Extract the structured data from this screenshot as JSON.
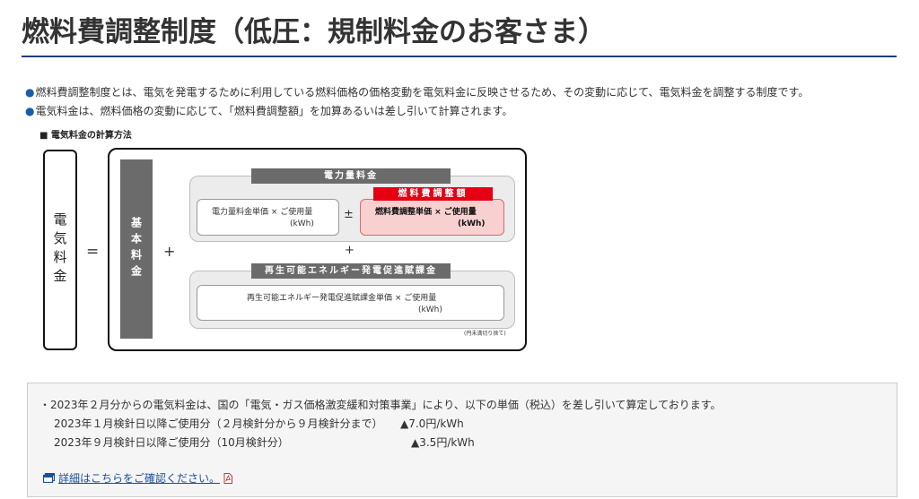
{
  "page": {
    "title": "燃料費調整制度（低圧：規制料金のお客さま）"
  },
  "bullets": [
    "燃料費調整制度とは、電気を発電するために利用している燃料価格の価格変動を電気料金に反映させるため、その変動に応じて、電気料金を調整する制度です。",
    "電気料金は、燃料価格の変動に応じて、「燃料費調整額」を加算あるいは差し引いて計算されます。"
  ],
  "bullet_marker": "●",
  "figure": {
    "caption": "■ 電気料金の計算方法",
    "denki_ryokin": "電気料金",
    "equals": "=",
    "kihon_ryokin": "基本料金",
    "plus": "+",
    "plus_minus": "±",
    "denryoku_panel": {
      "header": "電力量料金",
      "left_line1": "電力量料金単価 × ご使用量",
      "left_line2": "(kWh)",
      "fuel_label": "燃料費調整額",
      "fuel_line1": "燃料費調整単価 × ご使用量",
      "fuel_line2": "(kWh)"
    },
    "saiene_panel": {
      "header": "再生可能エネルギー発電促進賦課金",
      "line1": "再生可能エネルギー発電促進賦課金単価 × ご使用量",
      "line2": "(kWh)"
    },
    "note": "(円未満切り捨て)"
  },
  "info": {
    "line1": "・2023年２月分からの電気料金は、国の「電気・ガス価格激変緩和対策事業」により、以下の単価（税込）を差し引いて算定しております。",
    "rows": [
      {
        "label": "2023年１月検針日以降ご使用分（２月検針分から９月検針分まで）",
        "value": "▲7.0円/kWh"
      },
      {
        "label": "2023年９月検針日以降ご使用分（10月検針分）",
        "value": "▲3.5円/kWh"
      }
    ],
    "link_text": "詳細はこちらをご確認ください。"
  },
  "icons": {
    "window": "external-window-icon",
    "pdf": "pdf-icon"
  },
  "colors": {
    "title_rule": "#1f3c7a",
    "bullet": "#1a5dab",
    "fuel_red": "#e60012",
    "fuel_pink": "#f8d0d0",
    "link": "#1a4fa0"
  }
}
